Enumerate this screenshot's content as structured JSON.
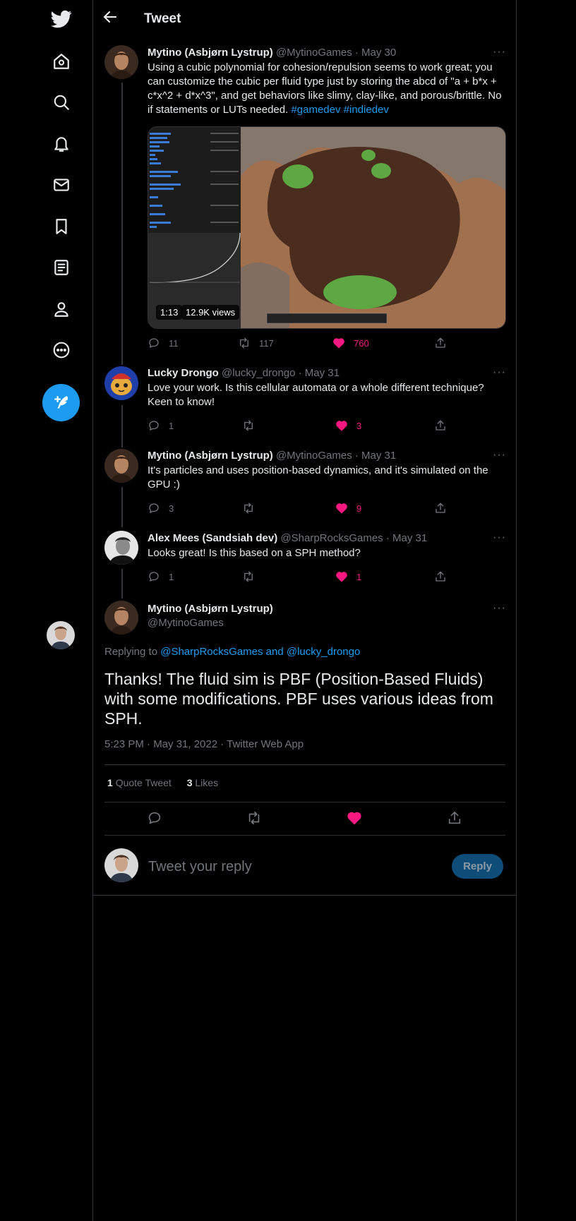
{
  "header": {
    "title": "Tweet"
  },
  "tweets": [
    {
      "name": "Mytino (Asbjørn Lystrup)",
      "handle": "@MytinoGames",
      "date": "· May 30",
      "text": "Using a cubic polynomial for cohesion/repulsion seems to work great; you can customize the cubic per fluid type just by storing the abcd of \"a + b*x + c*x^2 + d*x^3\", and get behaviors like slimy, clay-like, and porous/brittle. No if statements or LUTs needed. ",
      "hashtags": "#gamedev #indiedev",
      "media": {
        "duration": "1:13",
        "views": "12.9K views"
      },
      "replies": "11",
      "retweets": "117",
      "likes": "760"
    },
    {
      "name": "Lucky Drongo",
      "handle": "@lucky_drongo",
      "date": "· May 31",
      "text": "Love your work. Is this cellular automata or a whole different technique? Keen to know!",
      "replies": "1",
      "retweets": "",
      "likes": "3"
    },
    {
      "name": "Mytino (Asbjørn Lystrup)",
      "handle": "@MytinoGames",
      "date": "· May 31",
      "text": "It's particles and uses position-based dynamics, and it's simulated on the GPU :)",
      "replies": "3",
      "retweets": "",
      "likes": "9"
    },
    {
      "name": "Alex Mees (Sandsiah dev)",
      "handle": "@SharpRocksGames",
      "date": "· May 31",
      "text": "Looks great! Is this based on a SPH method?",
      "replies": "1",
      "retweets": "",
      "likes": "1"
    }
  ],
  "focused": {
    "name": "Mytino (Asbjørn Lystrup)",
    "handle": "@MytinoGames",
    "replying_prefix": "Replying to ",
    "replying_to": "@SharpRocksGames and @lucky_drongo",
    "text": "Thanks! The fluid sim is PBF (Position-Based Fluids) with some modifications. PBF uses various ideas from SPH.",
    "timestamp": "5:23 PM · May 31, 2022 · Twitter Web App",
    "quote_count": "1",
    "quote_label": "Quote Tweet",
    "likes_count": "3",
    "likes_label": "Likes"
  },
  "reply_box": {
    "placeholder": "Tweet your reply",
    "button": "Reply"
  },
  "colors": {
    "accent": "#1d9bf0",
    "like": "#f91880",
    "background": "#000000",
    "border": "#2f3336"
  },
  "icons": [
    "twitter-logo-icon",
    "home-icon",
    "explore-icon",
    "notifications-icon",
    "messages-icon",
    "bookmarks-icon",
    "lists-icon",
    "profile-icon",
    "more-icon",
    "compose-tweet-icon"
  ]
}
